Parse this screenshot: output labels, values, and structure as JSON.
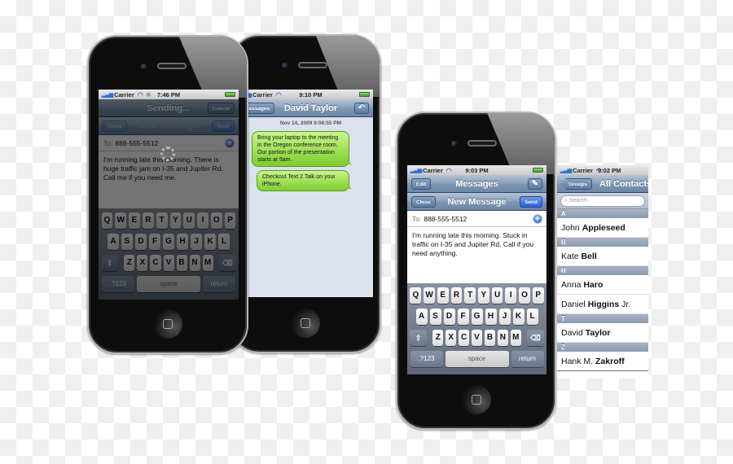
{
  "phone_sending": {
    "status": {
      "carrier": "Carrier",
      "time": "7:46 PM"
    },
    "top_nav": {
      "title": "Sending...",
      "right_button": "Cancel"
    },
    "compose_nav": {
      "left_button": "Close",
      "title": "New Message",
      "right_button": "Send"
    },
    "to": {
      "label": "To:",
      "value": "888-555-5512"
    },
    "message": "I'm running late this morning.  There is huge traffic jam on I-35 and Jupiter Rd.  Call me if you need me."
  },
  "phone_conversation": {
    "status": {
      "carrier": "Carrier",
      "time": "9:10 PM"
    },
    "nav": {
      "back_button": "Messages",
      "title": "David Taylor",
      "right_icon": "reply-arrow-icon"
    },
    "timestamp": "Nov 14, 2009 9:08:55 PM",
    "messages": [
      "Bring your laptop to the meeting in the Oregon conference room.  Our portion of the presentation starts at 9am.",
      "Checkout Text 2 Talk on your iPhone."
    ]
  },
  "phone_new_message": {
    "status": {
      "carrier": "Carrier",
      "time": "9:03 PM"
    },
    "top_nav": {
      "left_button": "Edit",
      "title": "Messages",
      "right_icon": "compose-icon"
    },
    "compose_nav": {
      "left_button": "Close",
      "title": "New Message",
      "right_button": "Send"
    },
    "to": {
      "label": "To:",
      "value": "888-555-5512"
    },
    "message": "I'm running late this morning.  Stuck in traffic on I-35 and Jupiter Rd.  Call if you need anything."
  },
  "keyboard": {
    "row1": [
      "Q",
      "W",
      "E",
      "R",
      "T",
      "Y",
      "U",
      "I",
      "O",
      "P"
    ],
    "row2": [
      "A",
      "S",
      "D",
      "F",
      "G",
      "H",
      "J",
      "K",
      "L"
    ],
    "row3": [
      "Z",
      "X",
      "C",
      "V",
      "B",
      "N",
      "M"
    ],
    "numbers_key": ".?123",
    "space_key": "space",
    "return_key": "return"
  },
  "contacts": {
    "status": {
      "carrier": "Carrier",
      "time": "9:02 PM"
    },
    "nav": {
      "back_button": "Groups",
      "title": "All Contacts"
    },
    "search_placeholder": "Search",
    "sections": [
      {
        "letter": "A",
        "contacts": [
          {
            "first": "John",
            "last": "Appleseed",
            "suffix": ""
          }
        ]
      },
      {
        "letter": "B",
        "contacts": [
          {
            "first": "Kate",
            "last": "Bell",
            "suffix": ""
          }
        ]
      },
      {
        "letter": "H",
        "contacts": [
          {
            "first": "Anna",
            "last": "Haro",
            "suffix": ""
          },
          {
            "first": "Daniel",
            "last": "Higgins",
            "suffix": "Jr."
          }
        ]
      },
      {
        "letter": "T",
        "contacts": [
          {
            "first": "David",
            "last": "Taylor",
            "suffix": ""
          }
        ]
      },
      {
        "letter": "Z",
        "contacts": [
          {
            "first": "Hank M.",
            "last": "Zakroff",
            "suffix": ""
          }
        ]
      }
    ]
  }
}
